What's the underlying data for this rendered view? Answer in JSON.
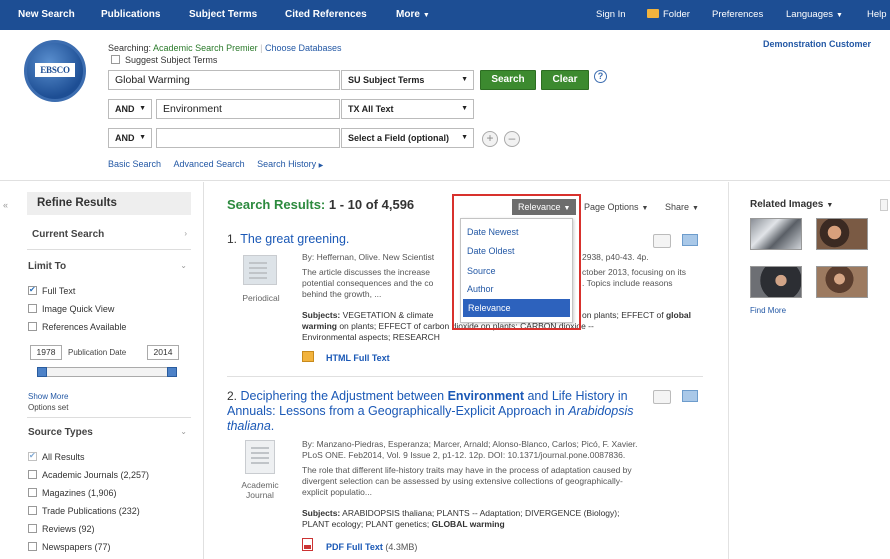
{
  "nav": {
    "items": [
      "New Search",
      "Publications",
      "Subject Terms",
      "Cited References",
      "More"
    ],
    "right": {
      "signin": "Sign In",
      "folder": "Folder",
      "preferences": "Preferences",
      "languages": "Languages",
      "help": "Help"
    }
  },
  "header": {
    "logo_text": "EBSCO",
    "searching_label": "Searching:",
    "database": "Academic Search Premier",
    "choose_db": "Choose Databases",
    "suggest": "Suggest Subject Terms",
    "demo_customer": "Demonstration Customer",
    "row1": {
      "value": "Global Warming",
      "field": "SU Subject Terms"
    },
    "row2": {
      "op": "AND",
      "value": "Environment",
      "field": "TX All Text"
    },
    "row3": {
      "op": "AND",
      "value": "",
      "field": "Select a Field (optional)"
    },
    "search_btn": "Search",
    "clear_btn": "Clear",
    "help_icon": "?",
    "add": "+",
    "remove": "–",
    "links": [
      "Basic Search",
      "Advanced Search",
      "Search History"
    ]
  },
  "left": {
    "refine": "Refine Results",
    "current_search": "Current Search",
    "limit_to": "Limit To",
    "limits": [
      "Full Text",
      "Image Quick View",
      "References Available"
    ],
    "date_from": "1978",
    "date_label": "Publication Date",
    "date_to": "2014",
    "show_more": "Show More",
    "options_set": "Options set",
    "source_types": "Source Types",
    "sources": [
      "All Results",
      "Academic Journals (2,257)",
      "Magazines (1,906)",
      "Trade Publications (232)",
      "Reviews (92)",
      "Newspapers (77)"
    ]
  },
  "results": {
    "title": "Search Results:",
    "count": "1 - 10 of 4,596",
    "sort_label": "Relevance",
    "page_options": "Page Options",
    "share": "Share",
    "sort_options": [
      "Date Newest",
      "Date Oldest",
      "Source",
      "Author",
      "Relevance"
    ],
    "items": [
      {
        "num": "1.",
        "title": "The great greening.",
        "meta1": "By: Heffernan, Olive. New Scientist",
        "meta1b": "2938, p40-43. 4p.",
        "abs1": "The article discusses the increase",
        "abs1b": "ctober 2013, focusing on its",
        "abs2": "potential consequences and the co",
        "abs2b": ". Topics include reasons",
        "abs3": "behind the growth, ...",
        "subj1a": "Subjects:",
        "subj1b": "VEGETATION & climate",
        "subj1c": "on plants; EFFECT of",
        "subj1d": "global",
        "subj2a": "warming",
        "subj2b": "on plants; EFFECT of carbon dioxide on plants; CARBON dioxide --",
        "subj3": "Environmental aspects; RESEARCH",
        "type": "Periodical",
        "link": "HTML Full Text"
      },
      {
        "num": "2.",
        "title_a": "Deciphering the Adjustment between",
        "title_b": "Environment",
        "title_c": "and Life",
        "title_d": "History in Annuals: Lessons from a Geographically-Explicit",
        "title_e": "Approach in",
        "title_f": "Arabidopsis thaliana",
        "meta1": "By: Manzano-Piedras, Esperanza; Marcer, Arnald; Alonso-Blanco, Carlos; Picó, F. Xavier.",
        "meta2": "PLoS ONE. Feb2014, Vol. 9 Issue 2, p1-12. 12p. DOI: 10.1371/journal.pone.0087836.",
        "abs1": "The role that different life-history traits may have in the process of adaptation caused by",
        "abs2": "divergent selection can be assessed by using extensive collections of geographically-",
        "abs3": "explicit populatio...",
        "subj1a": "Subjects:",
        "subj1b": "ARABIDOPSIS thaliana; PLANTS -- Adaptation; DIVERGENCE (Biology);",
        "subj2a": "PLANT ecology; PLANT genetics;",
        "subj2b": "GLOBAL warming",
        "type1": "Academic",
        "type2": "Journal",
        "link": "PDF Full Text",
        "size": "(4.3MB)"
      }
    ]
  },
  "related": {
    "title": "Related Images",
    "find_more": "Find More"
  }
}
